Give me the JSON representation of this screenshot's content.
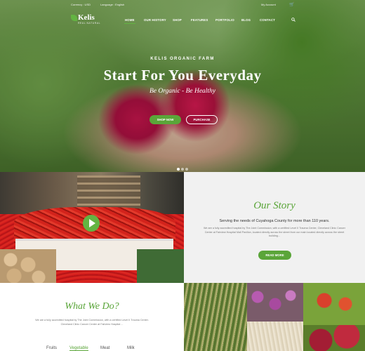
{
  "topbar": {
    "currency": "Currency : USD",
    "language": "Language : English",
    "account": "My Account",
    "cart_icon": "cart-icon"
  },
  "brand": {
    "name": "Kelis",
    "tagline": "REAL NATURAL",
    "accent": "#5aa539"
  },
  "nav": {
    "items": [
      "HOME",
      "OUR HISTORY",
      "SHOP",
      "FEATURES",
      "PORTFOLIO",
      "BLOG",
      "CONTACT"
    ],
    "active": "HOME",
    "search_icon": "search-icon"
  },
  "hero": {
    "kicker": "KELIS ORGANIC FARM",
    "title": "Start For You Everyday",
    "subtitle": "Be Organic - Be Healthy",
    "primary_button": "SHOP NOW",
    "secondary_button": "PURCHASE",
    "slides": 3,
    "active_slide": 1
  },
  "story": {
    "title": "Our Story",
    "heading": "Serving the needs of Cuyahoga County for more than 110 years.",
    "body": "We are a fully accredited hospital by The Joint Commission, with a certified Level II Trauma Center, Cleveland Clinic Cancer Center at Fairview Hospital Mall Pavilion, located directly across the street from our main located directly across the street building...",
    "button": "READ MORE"
  },
  "what_we_do": {
    "title": "What We Do?",
    "body": "We are a fully accredited hospital by The Joint Commission, with a certified Level II Trauma Center. Cleveland Clinic Cancer Center at Fairview Hospital ...",
    "categories": [
      "Fruits",
      "Vegetable",
      "Meat",
      "Milk"
    ],
    "selected": "Vegetable"
  }
}
